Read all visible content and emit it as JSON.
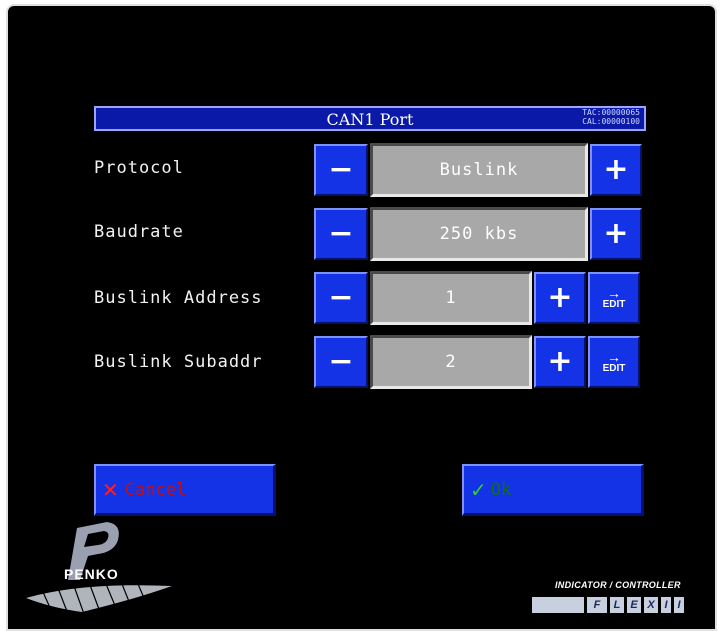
{
  "title": "CAN1 Port",
  "info": {
    "tac": "TAC:00000065",
    "cal": "CAL:00000100"
  },
  "settings": [
    {
      "label": "Protocol",
      "value": "Buslink"
    },
    {
      "label": "Baudrate",
      "value": "250 kbs"
    },
    {
      "label": "Buslink Address",
      "value": "1",
      "edit_label": "EDIT"
    },
    {
      "label": "Buslink Subaddr",
      "value": "2",
      "edit_label": "EDIT"
    }
  ],
  "buttons": {
    "minus": "−",
    "plus": "+",
    "cancel": "Cancel",
    "ok": "Ok"
  },
  "footer": {
    "logo_text": "PENKO",
    "tagline": "INDICATOR / CONTROLLER",
    "product_letters": [
      "",
      "F",
      "L",
      "E",
      "X",
      "I",
      "I"
    ]
  },
  "colors": {
    "button_blue": "#1432e6",
    "title_blue": "#0a19a8",
    "value_gray": "#a8a8a8",
    "cancel_red": "#c01010",
    "ok_green": "#107010"
  }
}
